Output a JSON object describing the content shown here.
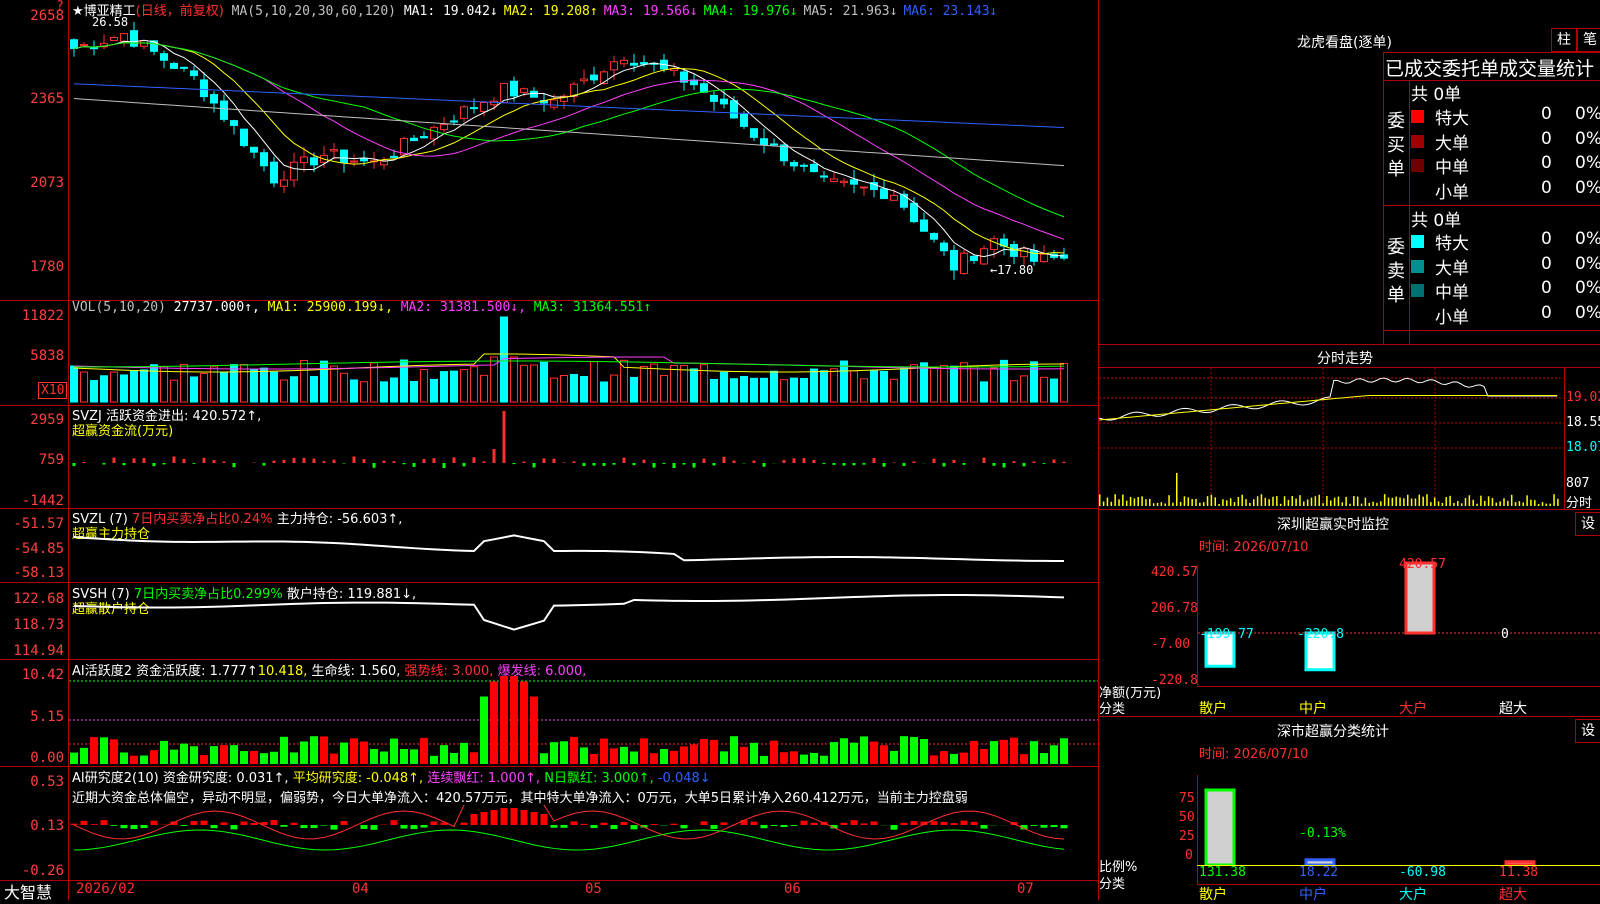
{
  "stock": {
    "name": "★博亚精工",
    "period": "(日线，前复权)"
  },
  "main_panel": {
    "ma_prefix": "MA(5,10,20,30,60,120)",
    "ma": [
      {
        "label": "MA1: 19.042↓",
        "color": "#ffffff"
      },
      {
        "label": "MA2: 19.208↑",
        "color": "#ffff00"
      },
      {
        "label": "MA3: 19.566↓",
        "color": "#ff40ff"
      },
      {
        "label": "MA4: 19.976↓",
        "color": "#00ff00"
      },
      {
        "label": "MA5: 21.963↓",
        "color": "#c0c0c0"
      },
      {
        "label": "MA6: 23.143↓",
        "color": "#3060ff"
      }
    ],
    "y_ticks": [
      "2658",
      "2365",
      "2073",
      "1780"
    ],
    "high_label": "26.58",
    "low_label": "←17.80"
  },
  "vol_panel": {
    "title_prefix": "VOL(5,10,20)",
    "value": "27737.000↑,",
    "ma1": "MA1: 25900.199↓,",
    "ma2": "MA2: 31381.500↓,",
    "ma3": "MA3: 31364.551↑",
    "y_ticks": [
      "11822",
      "5838"
    ],
    "unit": "X10"
  },
  "svzj_panel": {
    "title": "SVZJ  活跃资金进出: 420.572↑,",
    "subtitle": "超赢资金流(万元)",
    "y_ticks": [
      "2959",
      "759",
      "-1442"
    ]
  },
  "svzl_panel": {
    "title_prefix": "SVZL (7)",
    "ratio": "7日内买卖净占比0.24%",
    "holding": "主力持仓: -56.603↑,",
    "subtitle": "超赢主力持仓",
    "y_ticks": [
      "-51.57",
      "-54.85",
      "-58.13"
    ]
  },
  "svsh_panel": {
    "title_prefix": "SVSH (7)",
    "ratio": "7日内买卖净占比0.299%",
    "holding": "散户持仓: 119.881↓,",
    "subtitle": "超赢散户持仓",
    "y_ticks": [
      "122.68",
      "118.73",
      "114.94"
    ]
  },
  "ai_active_panel": {
    "title": "AI活跃度2 资金活跃度: 1.777↑",
    "v2": "10.418,",
    "life": "生命线: 1.560,",
    "strong": "强势线: 3.000,",
    "burst": "爆发线: 6.000,",
    "y_ticks": [
      "10.42",
      "5.15",
      "0.00"
    ]
  },
  "ai_research_panel": {
    "title": "AI研究度2(10) 资金研究度: 0.031↑,",
    "avg": "平均研究度: -0.048↑,",
    "cont": "连续飘红: 1.000↑,",
    "nday": "N日飘红: 3.000↑,",
    "last": "-0.048↓",
    "comment": "近期大资金总体偏空，异动不明显，偏弱势，今日大单净流入：420.57万元，其中特大单净流入：0万元，大单5日累计净入260.412万元，当前主力控盘弱",
    "y_ticks": [
      "0.53",
      "0.13",
      "-0.26"
    ]
  },
  "x_axis": {
    "labels": [
      "2026/02",
      "04",
      "05",
      "06",
      "07"
    ]
  },
  "brand": "大智慧",
  "dragon": {
    "title": "龙虎看盘(逐单)",
    "btn1": "柱",
    "btn2": "笔",
    "header": "已成交委托单成交量统计",
    "buy_label": "委买单",
    "sell_label": "委卖单",
    "buy_total": "共 0单",
    "sell_total": "共 0单",
    "buy_rows": [
      {
        "name": "特大",
        "count": "0",
        "pct": "0%",
        "color": "#ff0000"
      },
      {
        "name": "大单",
        "count": "0",
        "pct": "0%",
        "color": "#a00000"
      },
      {
        "name": "中单",
        "count": "0",
        "pct": "0%",
        "color": "#700000"
      },
      {
        "name": "小单",
        "count": "0",
        "pct": "0%",
        "color": "#000000"
      }
    ],
    "sell_rows": [
      {
        "name": "特大",
        "count": "0",
        "pct": "0%",
        "color": "#00ffff"
      },
      {
        "name": "大单",
        "count": "0",
        "pct": "0%",
        "color": "#009090"
      },
      {
        "name": "中单",
        "count": "0",
        "pct": "0%",
        "color": "#007070"
      },
      {
        "name": "小单",
        "count": "0",
        "pct": "0%",
        "color": "#000000"
      }
    ]
  },
  "intraday": {
    "title": "分时走势",
    "y_ticks": [
      "19.02",
      "18.55",
      "18.07"
    ],
    "vol_tick": "807",
    "vol_label": "分时"
  },
  "sz_monitor": {
    "title": "深圳超赢实时监控",
    "btn": "设",
    "time": "时间: 2026/07/10",
    "y_ticks": [
      "420.57",
      "206.78",
      "-7.00",
      "-220.8"
    ],
    "bars": [
      {
        "label": "散户",
        "value": "-199.77",
        "val": -199.77
      },
      {
        "label": "中户",
        "value": "-220.8",
        "val": -220.8
      },
      {
        "label": "大户",
        "value": "420.57",
        "val": 420.57
      },
      {
        "label": "超大",
        "value": "0",
        "val": 0
      }
    ],
    "axis_label1": "净额(万元)",
    "axis_label2": "分类"
  },
  "sz_class": {
    "title": "深市超赢分类统计",
    "btn": "设",
    "time": "时间: 2026/07/10",
    "y_ticks": [
      "75",
      "50",
      "25",
      "0"
    ],
    "bars": [
      {
        "label": "散户",
        "value": "131.38",
        "val": 131.38
      },
      {
        "label": "中户",
        "value": "18.22",
        "val": 18.22
      },
      {
        "label": "大户",
        "value": "-60.98",
        "val": -60.98
      },
      {
        "label": "超大",
        "value": "11.38",
        "val": 11.38
      }
    ],
    "mid_label": "-0.13%",
    "axis_label1": "比例%",
    "axis_label2": "分类"
  }
}
